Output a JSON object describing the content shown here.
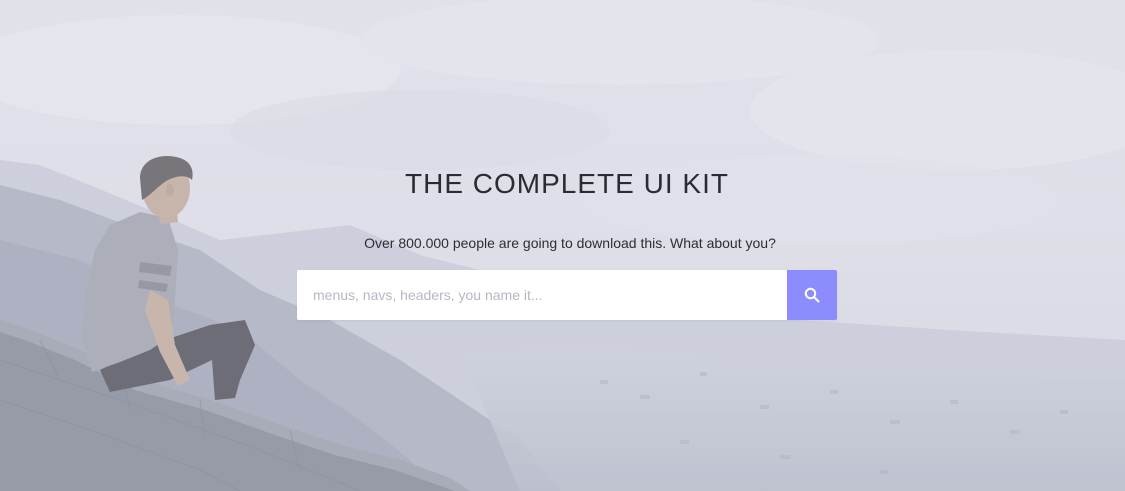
{
  "hero": {
    "title": "THE COMPLETE UI KIT",
    "subtitle": "Over 800.000 people are going to download this. What about you?"
  },
  "search": {
    "placeholder": "menus, navs, headers, you name it...",
    "value": "",
    "button_icon": "search-icon"
  },
  "colors": {
    "accent": "#8c8cff",
    "title_text": "#2b2b35",
    "input_bg": "#ffffff",
    "placeholder_text": "#b6b7c3"
  },
  "background_image": "photo of a man sitting on a stone wall overlooking a misty valley and city"
}
